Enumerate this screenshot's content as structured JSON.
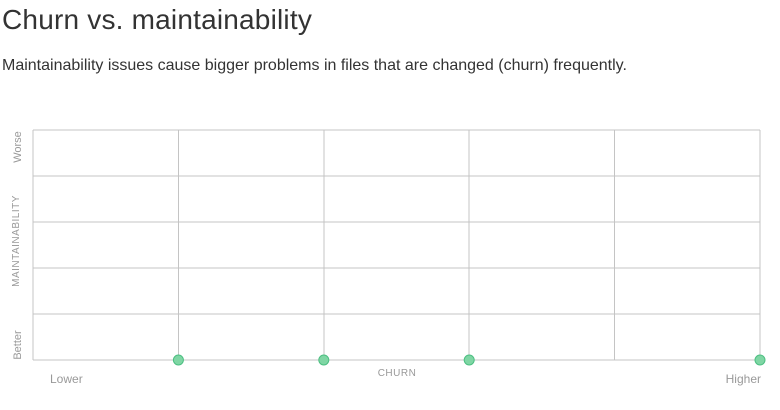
{
  "header": {
    "title": "Churn vs. maintainability",
    "subtitle": "Maintainability issues cause bigger problems in files that are changed (churn) frequently."
  },
  "chart_data": {
    "type": "scatter",
    "title": "Churn vs. maintainability",
    "xlabel": "CHURN",
    "ylabel": "MAINTAINABILITY",
    "x_scale_labels": {
      "low": "Lower",
      "high": "Higher"
    },
    "y_scale_labels": {
      "high": "Worse",
      "low": "Better"
    },
    "xlim": [
      0,
      5
    ],
    "ylim": [
      0,
      5
    ],
    "grid": true,
    "point_color": "#7fd6a4",
    "point_stroke": "#4cbf82",
    "points": [
      {
        "x": 1,
        "y": 0
      },
      {
        "x": 2,
        "y": 0
      },
      {
        "x": 3,
        "y": 0
      },
      {
        "x": 5,
        "y": 0
      }
    ]
  }
}
